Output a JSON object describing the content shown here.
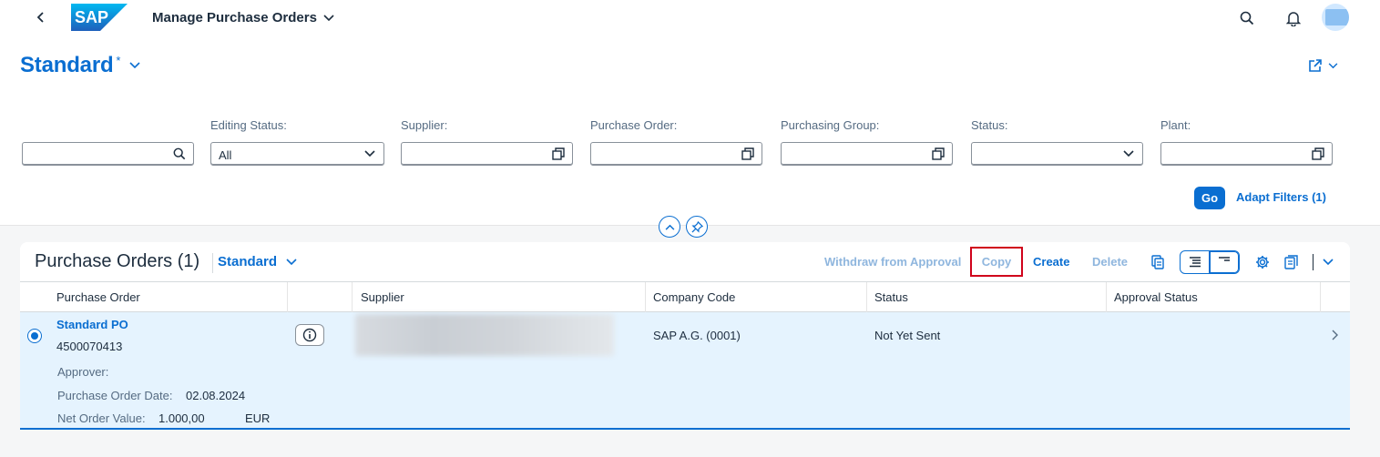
{
  "shell": {
    "app_title": "Manage Purchase Orders",
    "logo_text": "SAP"
  },
  "header": {
    "variant_title": "Standard",
    "variant_modified": "*"
  },
  "filters": [
    {
      "label": "",
      "value": "",
      "type": "search"
    },
    {
      "label": "Editing Status:",
      "value": "All",
      "type": "select"
    },
    {
      "label": "Supplier:",
      "value": "",
      "type": "valuehelp"
    },
    {
      "label": "Purchase Order:",
      "value": "",
      "type": "valuehelp"
    },
    {
      "label": "Purchasing Group:",
      "value": "",
      "type": "valuehelp"
    },
    {
      "label": "Status:",
      "value": "",
      "type": "select"
    },
    {
      "label": "Plant:",
      "value": "",
      "type": "valuehelp"
    }
  ],
  "filter_bar": {
    "go_label": "Go",
    "adapt_label": "Adapt Filters (1)"
  },
  "table": {
    "title": "Purchase Orders (1)",
    "variant": "Standard",
    "toolbar": {
      "withdraw": "Withdraw from Approval",
      "copy": "Copy",
      "create": "Create",
      "delete": "Delete"
    },
    "columns": [
      "Purchase Order",
      "",
      "Supplier",
      "Company Code",
      "Status",
      "Approval Status"
    ],
    "rows": [
      {
        "po_name": "Standard PO",
        "po_number": "4500070413",
        "company_code": "SAP A.G. (0001)",
        "status": "Not Yet Sent",
        "approval_status": "",
        "approver_label": "Approver:",
        "approver_value": "",
        "date_label": "Purchase Order Date:",
        "date_value": "02.08.2024",
        "net_label": "Net Order Value:",
        "net_value": "1.000,00",
        "currency": "EUR"
      }
    ]
  },
  "colors": {
    "brand_blue": "#0a6ed1",
    "highlight_red": "#d0021b",
    "selected_row": "#e5f3fe"
  }
}
